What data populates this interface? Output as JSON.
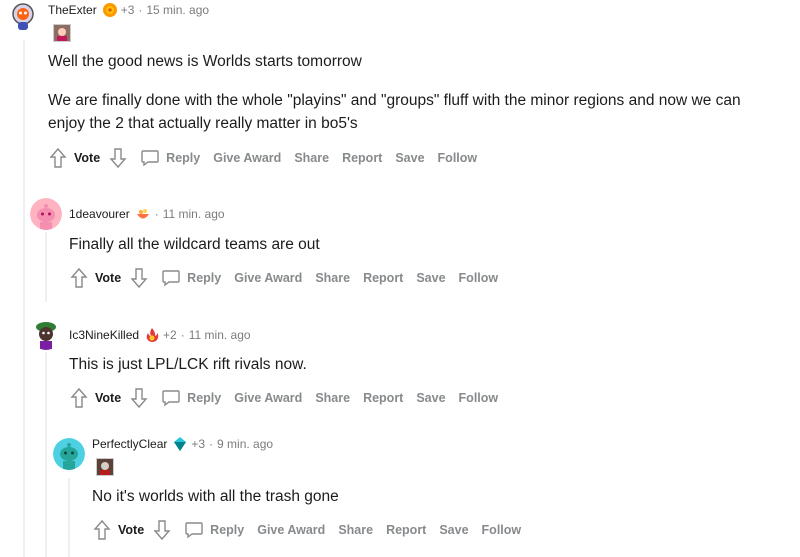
{
  "comments": [
    {
      "username": "TheExter",
      "plus": "+3",
      "dot": "·",
      "time": "15 min. ago",
      "body": [
        "Well the good news is Worlds starts tomorrow",
        "We are finally done with the whole \"playins\" and \"groups\" fluff with the minor regions and now we can enjoy the 2 that actually really matter in bo5's"
      ],
      "avatar": "snoo-avatar-exter",
      "flair": "orange-swirl-flair"
    },
    {
      "username": "1deavourer",
      "dot": "·",
      "time": "11 min. ago",
      "body": [
        "Finally all the wildcard teams are out"
      ],
      "avatar": "pink-snoo-avatar",
      "flair": "bowl-flair"
    },
    {
      "username": "Ic3NineKilled",
      "plus": "+2",
      "dot": "·",
      "time": "11 min. ago",
      "body": [
        "This is just LPL/LCK rift rivals now."
      ],
      "avatar": "snoo-avatar-green-hat",
      "flair": "fire-flair"
    },
    {
      "username": "PerfectlyClear",
      "plus": "+3",
      "dot": "·",
      "time": "9 min. ago",
      "body": [
        "No it's worlds with all the trash gone"
      ],
      "avatar": "teal-snoo-avatar",
      "flair": "crystal-flair"
    }
  ],
  "actions": {
    "vote": "Vote",
    "reply": "Reply",
    "give_award": "Give Award",
    "share": "Share",
    "report": "Report",
    "save": "Save",
    "follow": "Follow"
  },
  "colors": {
    "text": "#1c1c1c",
    "muted": "#878a8c",
    "thread": "#edeff1"
  }
}
